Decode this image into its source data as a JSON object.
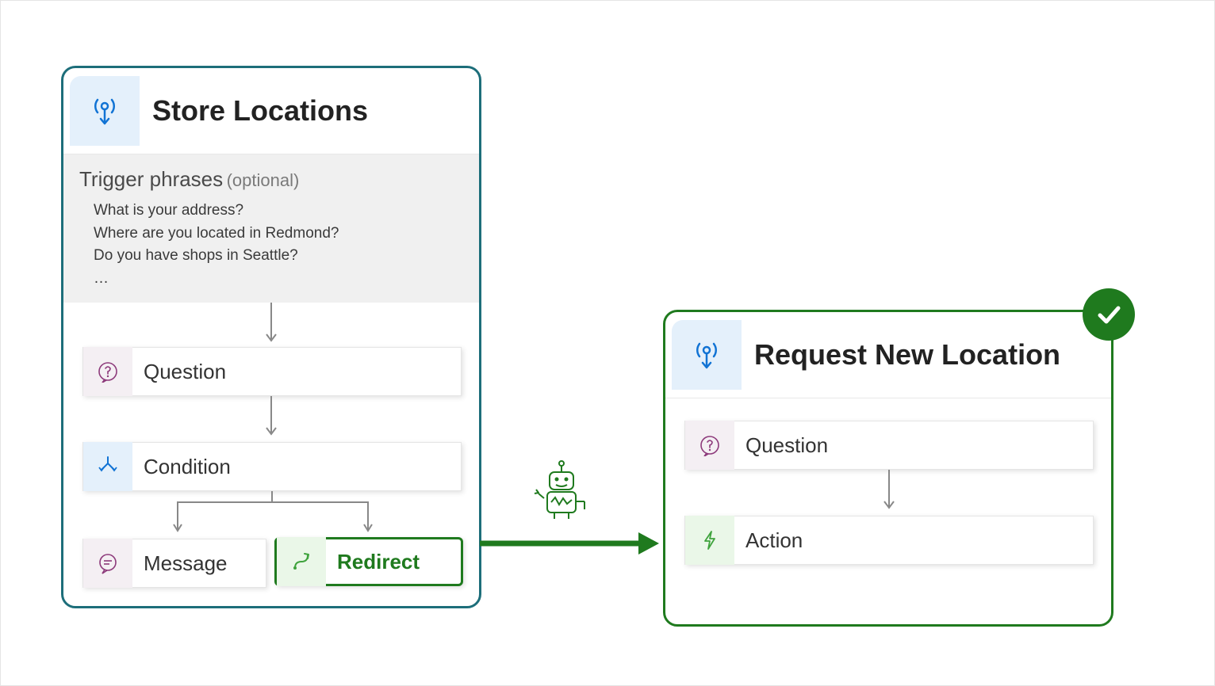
{
  "left_topic": {
    "title": "Store Locations",
    "trigger_label": "Trigger phrases",
    "trigger_optional": "(optional)",
    "trigger_phrases": [
      "What is your address?",
      "Where are you located in Redmond?",
      "Do you have shops in Seattle?",
      "…"
    ],
    "nodes": {
      "question": "Question",
      "condition": "Condition",
      "message": "Message",
      "redirect": "Redirect"
    }
  },
  "right_topic": {
    "title": "Request New Location",
    "nodes": {
      "question": "Question",
      "action": "Action"
    }
  },
  "icons": {
    "topic": "broadcast-icon",
    "question": "question-bubble-icon",
    "condition": "branch-icon",
    "message": "message-bubble-icon",
    "redirect": "redirect-arrow-icon",
    "action": "lightning-icon",
    "bot": "robot-icon",
    "check": "checkmark-icon"
  },
  "colors": {
    "teal": "#1d6e7a",
    "green": "#1f7a1e",
    "blue": "#1173d4",
    "purple": "#8d3a7b"
  }
}
